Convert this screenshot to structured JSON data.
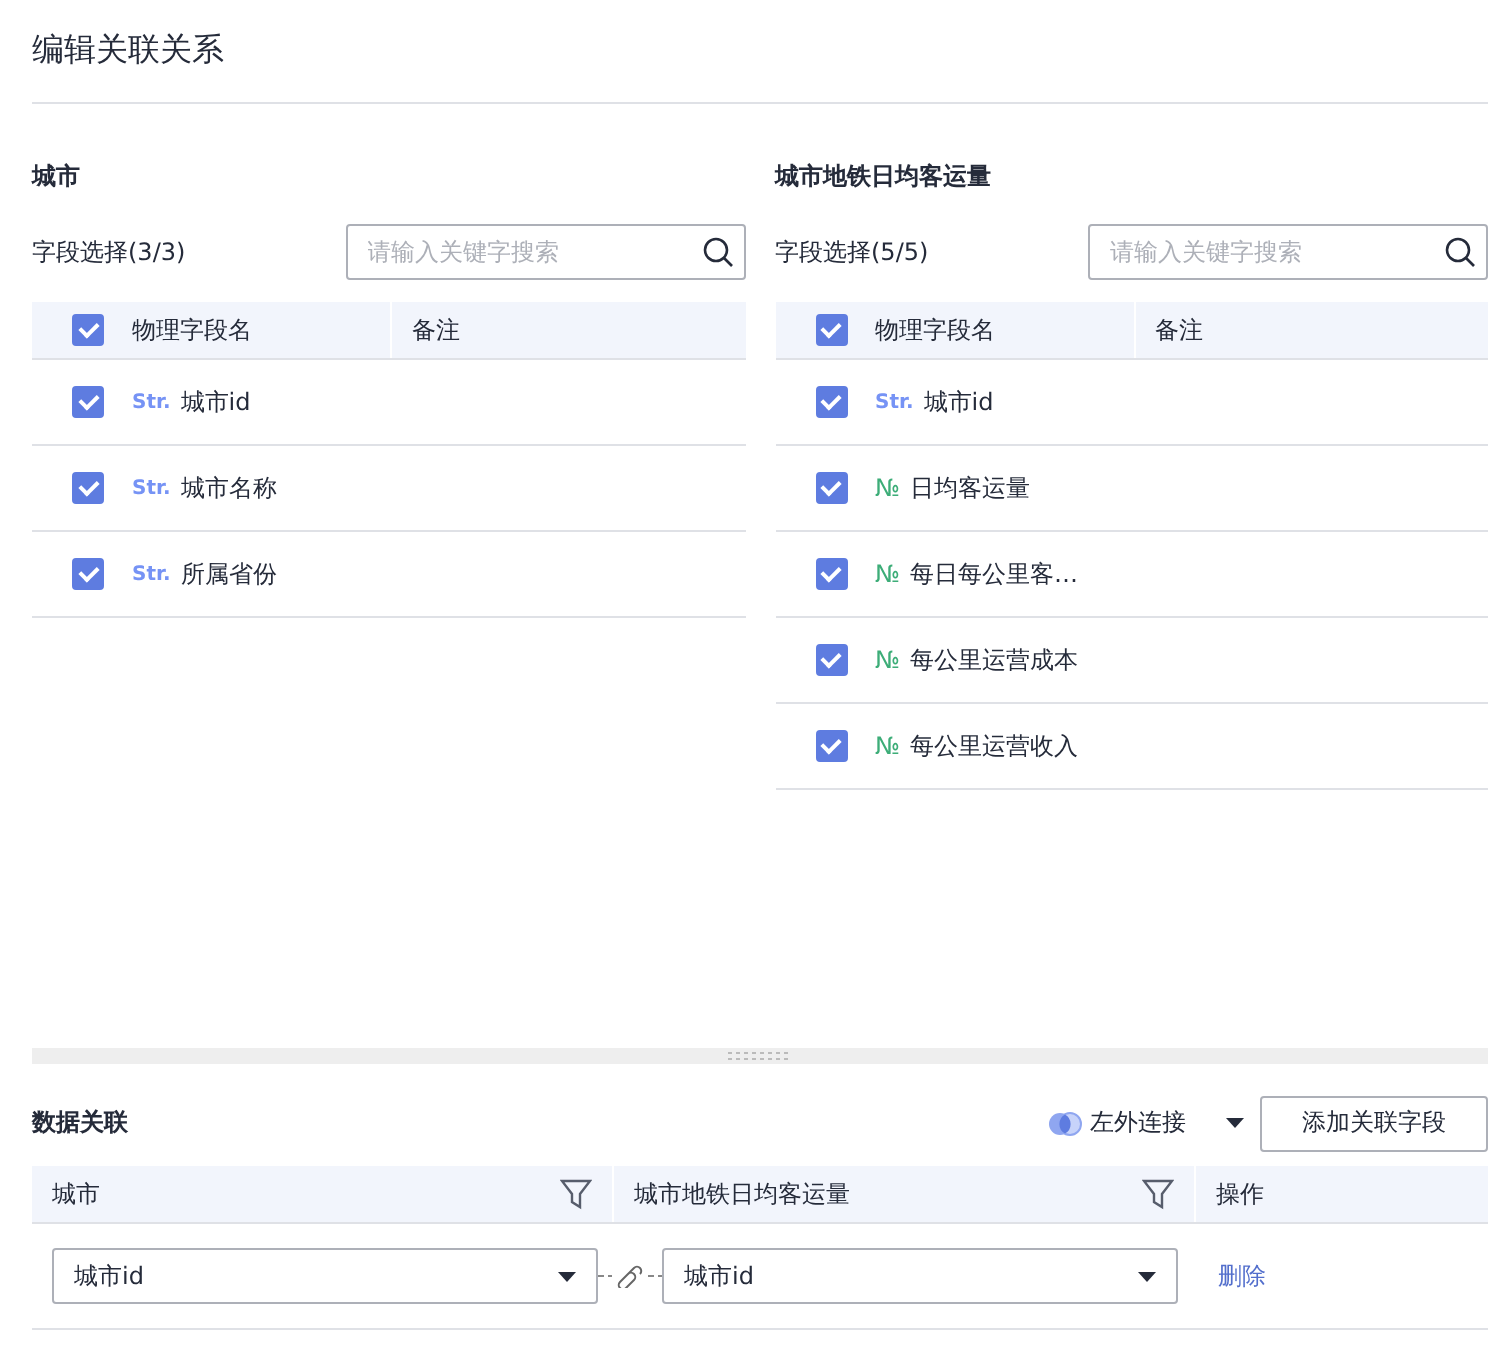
{
  "title": "编辑关联关系",
  "tables": [
    {
      "name": "城市",
      "count_label": "字段选择(3/3)",
      "search": {
        "placeholder": "请输入关键字搜索"
      },
      "columns": [
        "物理字段名",
        "备注"
      ],
      "all_checked": true,
      "fields": [
        {
          "kind": "str",
          "type_label": "Str.",
          "name": "城市id",
          "checked": true
        },
        {
          "kind": "str",
          "type_label": "Str.",
          "name": "城市名称",
          "checked": true
        },
        {
          "kind": "str",
          "type_label": "Str.",
          "name": "所属省份",
          "checked": true
        }
      ]
    },
    {
      "name": "城市地铁日均客运量",
      "count_label": "字段选择(5/5)",
      "search": {
        "placeholder": "请输入关键字搜索"
      },
      "columns": [
        "物理字段名",
        "备注"
      ],
      "all_checked": true,
      "fields": [
        {
          "kind": "str",
          "type_label": "Str.",
          "name": "城市id",
          "checked": true
        },
        {
          "kind": "num",
          "type_label": "№",
          "name": "日均客运量",
          "checked": true
        },
        {
          "kind": "num",
          "type_label": "№",
          "name": "每日每公里客…",
          "checked": true
        },
        {
          "kind": "num",
          "type_label": "№",
          "name": "每公里运营成本",
          "checked": true
        },
        {
          "kind": "num",
          "type_label": "№",
          "name": "每公里运营收入",
          "checked": true
        }
      ]
    }
  ],
  "relation": {
    "title": "数据关联",
    "join_type": "左外连接",
    "add_button": "添加关联字段",
    "columns": [
      "城市",
      "城市地铁日均客运量",
      "操作"
    ],
    "rows": [
      {
        "left": "城市id",
        "right": "城市id",
        "action": "删除"
      }
    ]
  }
}
